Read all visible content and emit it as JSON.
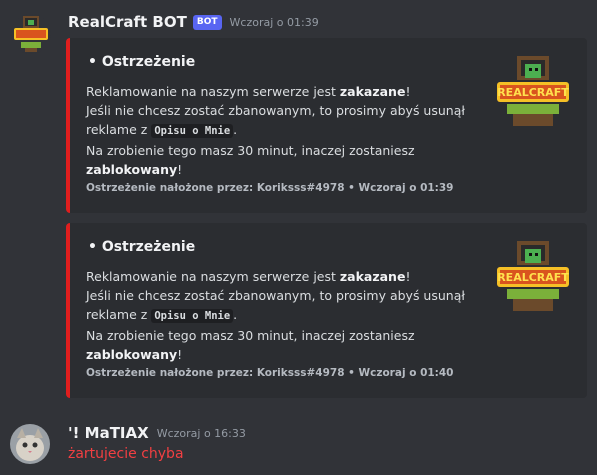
{
  "bot_message": {
    "username": "RealCraft BOT",
    "badge": "BOT",
    "timestamp": "Wczoraj o 01:39",
    "embeds": [
      {
        "title": "• Ostrzeżenie",
        "line1_a": "Reklamowanie na naszym serwerze jest ",
        "line1_b": "zakazane",
        "line1_c": "!",
        "line2": "Jeśli nie chcesz zostać zbanowanym, to prosimy abyś usunął",
        "line3_a": "reklame z ",
        "line3_code": "Opisu o Mnie",
        "line3_c": ".",
        "line4": "Na zrobienie tego masz 30 minut, inaczej zostaniesz",
        "line5_b": "zablokowany",
        "line5_c": "!",
        "footer": "Ostrzeżenie nałożone przez: Koriksss#4978 • Wczoraj o 01:39"
      },
      {
        "title": "• Ostrzeżenie",
        "line1_a": "Reklamowanie na naszym serwerze jest ",
        "line1_b": "zakazane",
        "line1_c": "!",
        "line2": "Jeśli nie chcesz zostać zbanowanym, to prosimy abyś usunął",
        "line3_a": "reklame z ",
        "line3_code": "Opisu o Mnie",
        "line3_c": ".",
        "line4": "Na zrobienie tego masz 30 minut, inaczej zostaniesz",
        "line5_b": "zablokowany",
        "line5_c": "!",
        "footer": "Ostrzeżenie nałożone przez: Koriksss#4978 • Wczoraj o 01:40"
      }
    ],
    "logo_text": "REALCRAFT"
  },
  "user_message": {
    "username": "'! MaTIAX",
    "timestamp": "Wczoraj o 16:33",
    "text": "żartujecie chyba"
  },
  "colors": {
    "background": "#313338",
    "embed_bg": "#2b2d31",
    "embed_accent": "#e01e1e",
    "bot_badge": "#5865f2",
    "user_message_text": "#f23f42"
  }
}
